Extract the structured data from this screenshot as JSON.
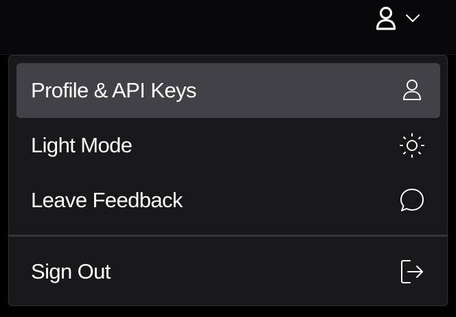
{
  "topbar": {
    "account_icon": "user-icon",
    "dropdown_icon": "chevron-down-icon"
  },
  "menu": {
    "items": [
      {
        "label": "Profile & API Keys",
        "icon": "user-icon",
        "active": true
      },
      {
        "label": "Light Mode",
        "icon": "sun-icon",
        "active": false
      },
      {
        "label": "Leave Feedback",
        "icon": "chat-bubble-icon",
        "active": false
      }
    ],
    "sign_out": {
      "label": "Sign Out",
      "icon": "sign-out-icon"
    }
  },
  "colors": {
    "background": "#000000",
    "topbar": "#08080a",
    "menu_background": "#18181b",
    "active_item": "#414146",
    "text": "#ffffff"
  }
}
